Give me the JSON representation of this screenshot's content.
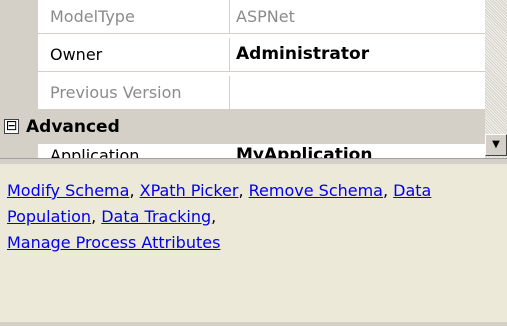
{
  "property_grid": {
    "rows": [
      {
        "name": "ModelType",
        "value": "ASPNet"
      },
      {
        "name": "Owner",
        "value": "Administrator"
      },
      {
        "name": "Previous Version",
        "value": ""
      }
    ],
    "category": {
      "toggle": "⊟",
      "label": "Advanced"
    },
    "partial_row": {
      "name": "Application",
      "value": "MyApplication"
    },
    "scroll_down_glyph": "▼"
  },
  "verbs": {
    "links": [
      {
        "label": "Modify Schema",
        "sep": ", "
      },
      {
        "label": "XPath Picker",
        "sep": ", "
      },
      {
        "label": "Remove Schema",
        "sep": ", "
      },
      {
        "label": "Data Population",
        "sep": ", "
      },
      {
        "label": "Data Tracking",
        "sep": ","
      },
      {
        "label": "Manage Process Attributes",
        "sep": ""
      }
    ]
  }
}
